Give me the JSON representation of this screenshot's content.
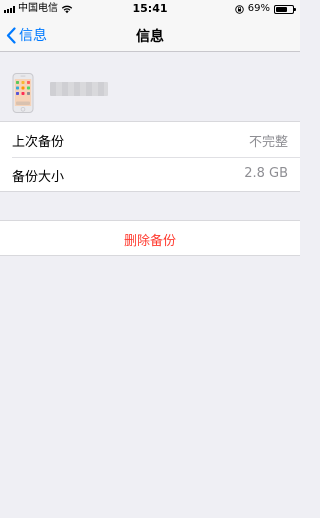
{
  "status_bar": {
    "carrier": "中国电信",
    "time": "15:41",
    "battery_text": "69%",
    "battery_level": 0.69
  },
  "nav": {
    "back_label": "信息",
    "title": "信息"
  },
  "info": {
    "rows": [
      {
        "label": "上次备份",
        "value": "不完整"
      },
      {
        "label": "备份大小",
        "value": "2.8 GB"
      }
    ]
  },
  "actions": {
    "delete_label": "删除备份"
  },
  "colors": {
    "accent": "#007aff",
    "destructive": "#ff3b30",
    "background": "#efeff4"
  }
}
